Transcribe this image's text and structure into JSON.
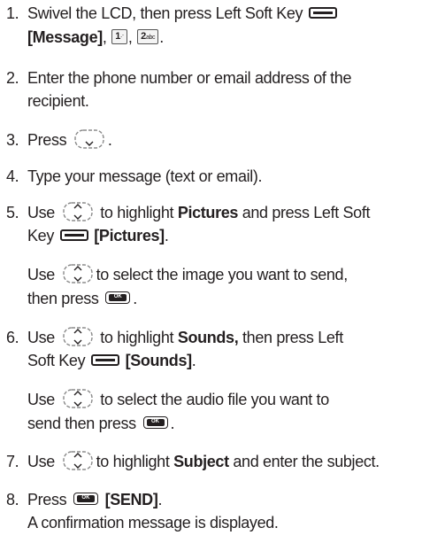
{
  "steps": [
    {
      "number": "1.",
      "line1_before": "Swivel the LCD, then press Left Soft Key",
      "line2_bold": "[Message]",
      "key1_digit": "1",
      "key1_sub": "",
      "key2_digit": "2",
      "key2_sub": "abc"
    },
    {
      "number": "2.",
      "line1": "Enter the phone number or email address of the",
      "line2": "recipient."
    },
    {
      "number": "3.",
      "text": "Press"
    },
    {
      "number": "4.",
      "text": "Type your message (text or email)."
    },
    {
      "number": "5.",
      "line1_before": "Use",
      "line1_mid": "to highlight",
      "line1_bold": "Pictures",
      "line1_after": "and press Left Soft",
      "line2_before": "Key",
      "line2_bold": "[Pictures]",
      "sub_line1_before": "Use",
      "sub_line1_after": "to select the image you want to send,",
      "sub_line2": "then press"
    },
    {
      "number": "6.",
      "line1_before": "Use",
      "line1_mid": "to highlight",
      "line1_bold": "Sounds,",
      "line1_after": "then press Left",
      "line2_before": "Soft Key",
      "line2_bold": "[Sounds]",
      "sub_line1_before": "Use",
      "sub_line1_after": "to select the audio file you want to",
      "sub_line2": "send then press"
    },
    {
      "number": "7.",
      "before": "Use",
      "mid": "to highlight",
      "bold": "Subject",
      "after": "and enter the subject."
    },
    {
      "number": "8.",
      "before": "Press",
      "bold": "[SEND]",
      "line2": "A confirmation message is displayed."
    }
  ],
  "ok_key_label": "OK",
  "icons": [
    "soft-key-icon",
    "keypad-1-icon",
    "keypad-2-icon",
    "nav-key-icon",
    "ok-key-icon"
  ]
}
